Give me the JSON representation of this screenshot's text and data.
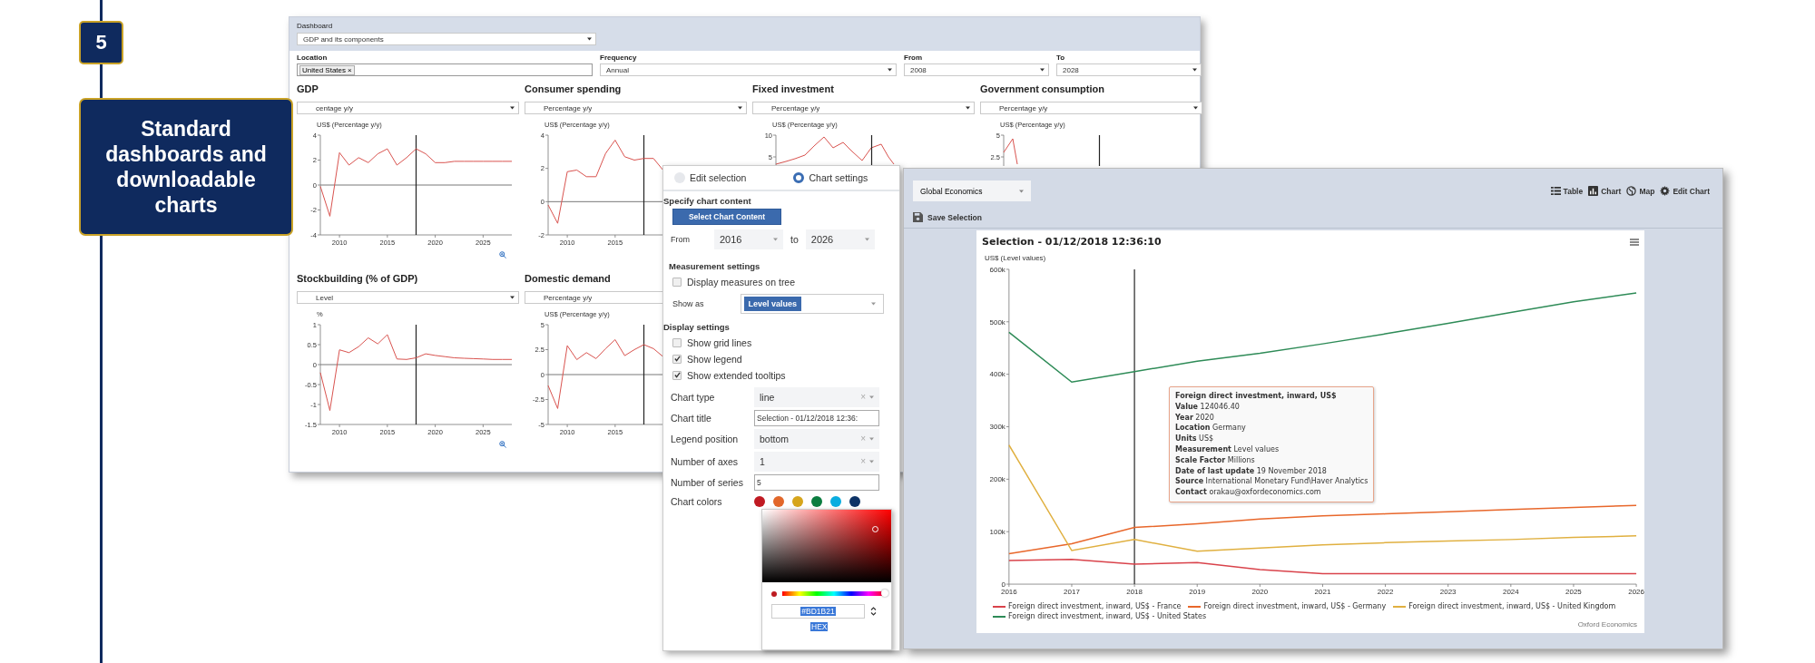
{
  "slide": {
    "number": "5",
    "callout": "Standard dashboards and downloadable charts"
  },
  "dashboard": {
    "label": "Dashboard",
    "select": "GDP and its components",
    "filters": [
      {
        "label": "Location",
        "kind": "tags",
        "tags": [
          {
            "text": "United States",
            "remove": "×"
          }
        ]
      },
      {
        "label": "Frequency",
        "kind": "select",
        "value": "Annual"
      },
      {
        "label": "From",
        "kind": "select",
        "value": "2008"
      },
      {
        "label": "To",
        "kind": "select",
        "value": "2028"
      }
    ],
    "panels": [
      {
        "title": "GDP",
        "measure": "centage y/y",
        "zoom_button": true,
        "chart_data": {
          "type": "line",
          "ylabel": "US$ (Percentage y/y)",
          "x": [
            2008,
            2009,
            2010,
            2011,
            2012,
            2013,
            2014,
            2015,
            2016,
            2017,
            2018,
            2019,
            2020,
            2021,
            2022,
            2023,
            2024,
            2025,
            2026,
            2027,
            2028
          ],
          "xlim": [
            2008,
            2028
          ],
          "ylim": [
            -4,
            4
          ],
          "xticks": [
            2010,
            2015,
            2020,
            2025
          ],
          "yticks": [
            -4,
            -2,
            0,
            2,
            4
          ],
          "ref_lines": [
            {
              "axis": "x",
              "value": 2018
            }
          ],
          "series": [
            {
              "values": [
                -0.1,
                -2.5,
                2.6,
                1.6,
                2.2,
                1.8,
                2.5,
                2.9,
                1.6,
                2.2,
                2.9,
                2.5,
                1.8,
                1.8,
                1.9,
                1.9,
                1.9,
                1.9,
                1.9,
                1.9,
                1.9
              ]
            }
          ]
        }
      },
      {
        "title": "Consumer spending",
        "measure": "Percentage y/y",
        "chart_data": {
          "type": "line",
          "ylabel": "US$ (Percentage y/y)",
          "x": [
            2008,
            2009,
            2010,
            2011,
            2012,
            2013,
            2014,
            2015,
            2016,
            2017,
            2018,
            2019,
            2020
          ],
          "xlim": [
            2008,
            2028
          ],
          "ylim": [
            -2,
            4
          ],
          "xticks": [
            2010,
            2015
          ],
          "yticks": [
            -2,
            0,
            2,
            4
          ],
          "ref_lines": [
            {
              "axis": "x",
              "value": 2018
            }
          ],
          "series": [
            {
              "values": [
                -0.2,
                -1.3,
                1.8,
                1.9,
                1.5,
                1.5,
                2.9,
                3.7,
                2.7,
                2.5,
                2.6,
                2.6,
                1.9
              ]
            }
          ]
        }
      },
      {
        "title": "Fixed investment",
        "measure": "Percentage y/y",
        "chart_picture": {
          "ylabel": "US$ (Percentage y/y)",
          "tick_labels": [
            "10",
            "5"
          ]
        }
      },
      {
        "title": "Government consumption",
        "measure": "Percentage y/y",
        "chart_picture": {
          "ylabel": "US$ (Percentage y/y)",
          "tick_labels": [
            "5",
            "2.5"
          ]
        }
      },
      {
        "title": "Stockbuilding (% of GDP)",
        "measure": "Level",
        "zoom_button": true,
        "chart_data": {
          "type": "line",
          "ylabel": "%",
          "x": [
            2008,
            2009,
            2010,
            2011,
            2012,
            2013,
            2014,
            2015,
            2016,
            2017,
            2018,
            2019,
            2020,
            2021,
            2022,
            2023,
            2024,
            2025,
            2026,
            2027,
            2028
          ],
          "xlim": [
            2008,
            2028
          ],
          "ylim": [
            -1.5,
            1
          ],
          "xticks": [
            2010,
            2015,
            2020,
            2025
          ],
          "yticks": [
            -1.5,
            -1,
            -0.5,
            0,
            0.5,
            1
          ],
          "ref_lines": [
            {
              "axis": "x",
              "value": 2018
            }
          ],
          "series": [
            {
              "values": [
                -0.2,
                -1.15,
                0.37,
                0.3,
                0.45,
                0.67,
                0.52,
                0.75,
                0.14,
                0.13,
                0.17,
                0.27,
                0.23,
                0.2,
                0.17,
                0.16,
                0.15,
                0.14,
                0.13,
                0.13,
                0.13
              ]
            }
          ]
        }
      },
      {
        "title": "Domestic demand",
        "measure": "Percentage y/y",
        "chart_data": {
          "type": "line",
          "ylabel": "US$ (Percentage y/y)",
          "x": [
            2008,
            2009,
            2010,
            2011,
            2012,
            2013,
            2014,
            2015,
            2016,
            2017,
            2018,
            2019,
            2020
          ],
          "xlim": [
            2008,
            2028
          ],
          "ylim": [
            -5,
            5
          ],
          "xticks": [
            2010,
            2015
          ],
          "yticks": [
            -5,
            -2.5,
            0,
            2.5,
            5
          ],
          "ref_lines": [
            {
              "axis": "x",
              "value": 2018
            }
          ],
          "series": [
            {
              "values": [
                -1.1,
                -3.4,
                2.9,
                1.5,
                2.2,
                1.6,
                2.6,
                3.5,
                1.9,
                2.5,
                3.0,
                2.6,
                1.8
              ]
            }
          ]
        }
      }
    ]
  },
  "chart_settings": {
    "modes": [
      {
        "label": "Edit selection",
        "selected": false
      },
      {
        "label": "Chart settings",
        "selected": true
      }
    ],
    "content_heading": "Specify chart content",
    "content_button": "Select Chart Content",
    "range": {
      "from_label": "From",
      "from": "2016",
      "to_label": "to",
      "to": "2026"
    },
    "measurement_heading": "Measurement settings",
    "measurement_options": [
      {
        "label": "Display measures on tree",
        "checked": false
      }
    ],
    "show_as": {
      "label": "Show as",
      "value": "Level values"
    },
    "display_heading": "Display settings",
    "display_options": [
      {
        "label": "Show grid lines",
        "checked": false
      },
      {
        "label": "Show legend",
        "checked": true
      },
      {
        "label": "Show extended tooltips",
        "checked": true
      }
    ],
    "fields": [
      {
        "label": "Chart type",
        "kind": "select",
        "value": "line",
        "clear": "×"
      },
      {
        "label": "Chart title",
        "kind": "text",
        "value": "Selection - 01/12/2018 12:36:"
      },
      {
        "label": "Legend position",
        "kind": "select",
        "value": "bottom",
        "clear": "×"
      },
      {
        "label": "Number of axes",
        "kind": "select",
        "value": "1",
        "clear": "×"
      },
      {
        "label": "Number of series",
        "kind": "text",
        "value": "5"
      }
    ],
    "colors_label": "Chart colors",
    "colors": [
      {
        "color": "#c01a22"
      },
      {
        "color": "#e2672a"
      },
      {
        "color": "#d6a51c"
      },
      {
        "color": "#0b7d40"
      },
      {
        "color": "#0aade0"
      },
      {
        "color": "#0d3366"
      }
    ],
    "color_picker": {
      "hex": "#BD1B21",
      "format": "HEX",
      "level": 0.99
    }
  },
  "explorer": {
    "dataset": "Global Economics",
    "views": [
      {
        "label": "Table",
        "kind": "table"
      },
      {
        "label": "Chart",
        "kind": "chart"
      },
      {
        "label": "Map",
        "kind": "globe"
      },
      {
        "label": "Edit Chart",
        "kind": "gear"
      }
    ],
    "save": "Save Selection",
    "chart": {
      "chart_data": {
        "type": "line",
        "title": "Selection - 01/12/2018 12:36:10",
        "ylabel": "US$ (Level values)",
        "x": [
          2016,
          2017,
          2018,
          2019,
          2020,
          2021,
          2022,
          2023,
          2024,
          2025,
          2026
        ],
        "xlim": [
          2016,
          2026
        ],
        "ylim": [
          0,
          600000
        ],
        "xticks": [
          2016,
          2017,
          2018,
          2019,
          2020,
          2021,
          2022,
          2023,
          2024,
          2025,
          2026
        ],
        "yticks": [
          {
            "value": 0,
            "label": "0"
          },
          {
            "value": 100000,
            "label": "100k"
          },
          {
            "value": 200000,
            "label": "200k"
          },
          {
            "value": 300000,
            "label": "300k"
          },
          {
            "value": 400000,
            "label": "400k"
          },
          {
            "value": 500000,
            "label": "500k"
          },
          {
            "value": 600000,
            "label": "600k"
          }
        ],
        "ref_lines": [
          {
            "axis": "x",
            "value": 2018
          }
        ],
        "series": [
          {
            "name": "Foreign direct investment, inward, US$ - France",
            "color": "#d9434b",
            "values": [
              45000,
              47000,
              38000,
              41000,
              28000,
              20000,
              20000,
              20000,
              20000,
              20000,
              20000
            ]
          },
          {
            "name": "Foreign direct investment, inward, US$ - Germany",
            "color": "#e8672b",
            "values": [
              58000,
              77000,
              108000,
              115000,
              124000,
              130000,
              134000,
              138000,
              142000,
              146000,
              150000
            ]
          },
          {
            "name": "Foreign direct investment, inward, US$ - United Kingdom",
            "color": "#e0b040",
            "values": [
              265000,
              64000,
              85000,
              63000,
              69000,
              75000,
              79000,
              82000,
              85000,
              89000,
              92000
            ]
          },
          {
            "name": "Foreign direct investment, inward, US$ - United States",
            "color": "#2e8b57",
            "values": [
              480000,
              385000,
              405000,
              425000,
              440000,
              458000,
              477000,
              497000,
              518000,
              538000,
              555000
            ]
          }
        ]
      },
      "tooltip": [
        "**Foreign direct investment, inward, US$**",
        "**Value** 124046.40",
        "**Year** 2020",
        "**Location** Germany",
        "**Units** US$",
        "**Measurement** Level values",
        "**Scale Factor** Millions",
        "**Date of last update** 19 November 2018",
        "**Source** International Monetary Fund\\Haver Analytics",
        "**Contact** orakau@oxfordeconomics.com"
      ],
      "credit": "Oxford Economics"
    }
  }
}
